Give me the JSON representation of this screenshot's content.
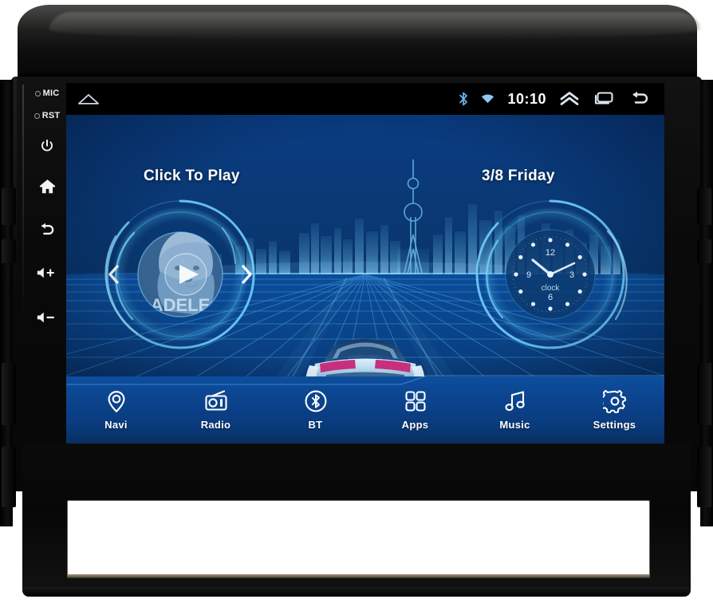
{
  "device": {
    "type": "car-head-unit",
    "os": "Android"
  },
  "hard_keys": [
    {
      "id": "mic",
      "label": "MIC",
      "icon": "microphone-indicator"
    },
    {
      "id": "rst",
      "label": "RST",
      "icon": "reset-pinhole"
    },
    {
      "id": "power",
      "label": "",
      "icon": "power-icon"
    },
    {
      "id": "home",
      "label": "",
      "icon": "home-icon"
    },
    {
      "id": "back",
      "label": "",
      "icon": "back-arrow-icon"
    },
    {
      "id": "volup",
      "label": "",
      "icon": "volume-up-icon"
    },
    {
      "id": "voldn",
      "label": "",
      "icon": "volume-down-icon"
    }
  ],
  "statusbar": {
    "home_icon": "home-icon",
    "bluetooth_icon": "bluetooth-icon",
    "wifi_icon": "wifi-icon",
    "clock": "10:10",
    "expand_icon": "chevron-up-icon",
    "recents_icon": "recents-icon",
    "back_icon": "back-arrow-icon"
  },
  "widgets": {
    "music": {
      "title": "Click To Play",
      "album_text": "ADELE",
      "prev_icon": "chevron-left-icon",
      "next_icon": "chevron-right-icon",
      "play_icon": "play-icon"
    },
    "clock": {
      "date": "3/8 Friday",
      "face_label": "clock",
      "numerals": [
        "12",
        "3",
        "6",
        "9"
      ],
      "hour_hand_deg": 300,
      "minute_hand_deg": 60
    }
  },
  "wallpaper": {
    "scene": "city-skyline-with-car-on-grid",
    "vehicle": "sports-car-rear-view",
    "colors": {
      "deep_blue": "#04204a",
      "mid_blue": "#0a3f86",
      "glow_cyan": "#4fc3f7",
      "grid_line": "#2f7fd4"
    }
  },
  "dock": {
    "items": [
      {
        "label": "Navi",
        "icon": "map-pin-icon"
      },
      {
        "label": "Radio",
        "icon": "radio-icon"
      },
      {
        "label": "BT",
        "icon": "bluetooth-circle-icon"
      },
      {
        "label": "Apps",
        "icon": "apps-grid-icon"
      },
      {
        "label": "Music",
        "icon": "music-note-icon"
      },
      {
        "label": "Settings",
        "icon": "gear-icon"
      }
    ]
  },
  "chassis": {
    "slot_label": ""
  }
}
